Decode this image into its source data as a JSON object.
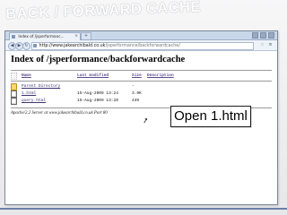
{
  "slide": {
    "title": "BACK / FORWARD CACHE",
    "callout": "Open 1.html"
  },
  "browser": {
    "tab_title": "Index of /jsperformanc...",
    "address_host": "http://www.jakearchibald.co.uk",
    "address_path": "/jsperformance/backforwardcache/"
  },
  "page": {
    "heading": "Index of /jsperformance/backforwardcache",
    "columns": [
      "Name",
      "Last modified",
      "Size",
      "Description"
    ],
    "rows": [
      {
        "name": "Parent Directory",
        "modified": "",
        "size": "-",
        "description": ""
      },
      {
        "name": "1.html",
        "modified": "15-Aug-2009 13:24",
        "size": "3.9K",
        "description": ""
      },
      {
        "name": "query.html",
        "modified": "15-Aug-2009 13:20",
        "size": "449",
        "description": ""
      }
    ],
    "server_signature": "Apache/2.2 Server at www.jakearchibald.co.uk Port 80"
  },
  "icons": {
    "header": "blank-icon",
    "parent": "folder-icon",
    "file": "file-icon",
    "cursor": "mouse-cursor-icon"
  },
  "colors": {
    "tab_strip": "#c9d7ea",
    "toolbar": "#eef3fa",
    "link": "#3e3370"
  }
}
